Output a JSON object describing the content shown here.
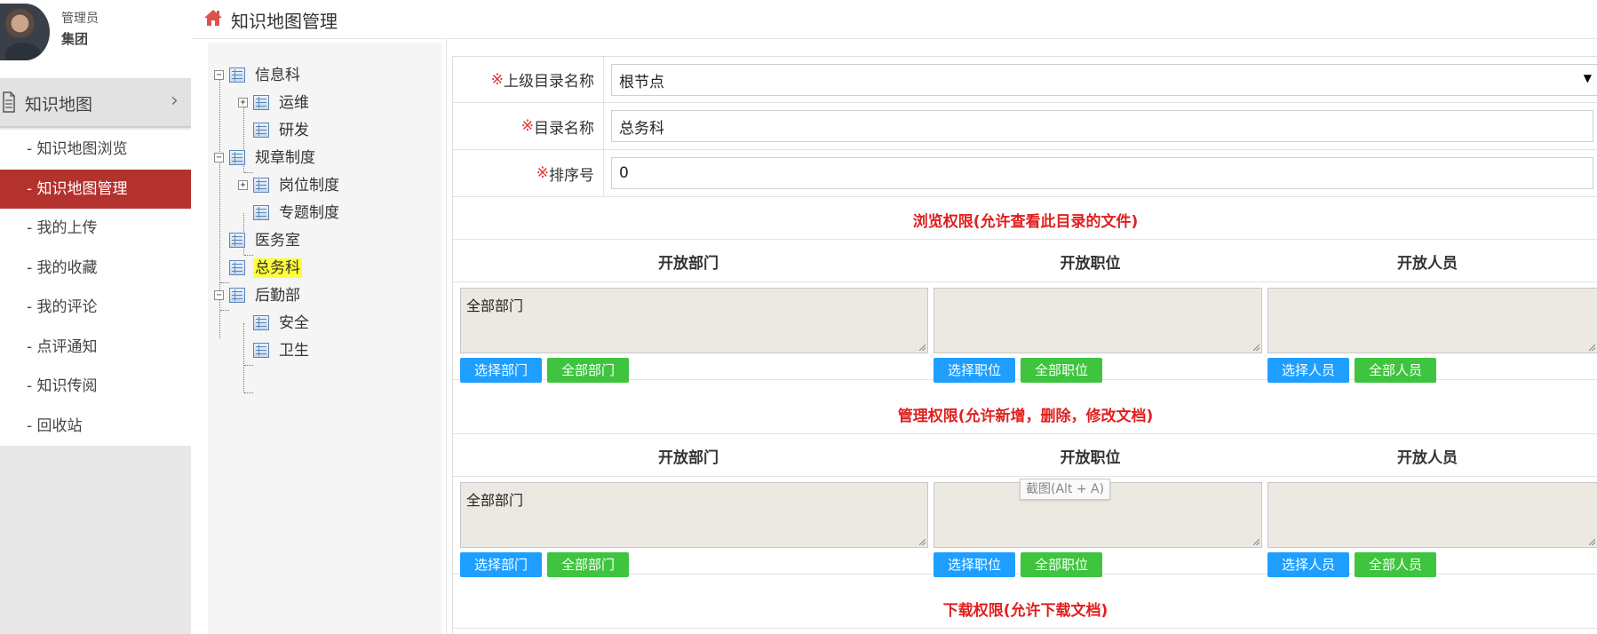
{
  "user": {
    "role": "管理员",
    "org": "集团"
  },
  "menu": {
    "title": "知识地图",
    "items": [
      {
        "label": "- 知识地图浏览",
        "active": false
      },
      {
        "label": "- 知识地图管理",
        "active": true
      },
      {
        "label": "- 我的上传",
        "active": false
      },
      {
        "label": "- 我的收藏",
        "active": false
      },
      {
        "label": "- 我的评论",
        "active": false
      },
      {
        "label": "- 点评通知",
        "active": false
      },
      {
        "label": "- 知识传阅",
        "active": false
      },
      {
        "label": "- 回收站",
        "active": false
      }
    ]
  },
  "header": {
    "title": "知识地图管理"
  },
  "tree": {
    "nodes": [
      {
        "label": "信息科",
        "toggle": "−"
      },
      {
        "label": "运维",
        "toggle": "+"
      },
      {
        "label": "研发"
      },
      {
        "label": "规章制度",
        "toggle": "−"
      },
      {
        "label": "岗位制度",
        "toggle": "+"
      },
      {
        "label": "专题制度"
      },
      {
        "label": "医务室"
      },
      {
        "label": "总务科",
        "selected": true
      },
      {
        "label": "后勤部",
        "toggle": "−"
      },
      {
        "label": "安全"
      },
      {
        "label": "卫生"
      }
    ]
  },
  "form": {
    "required_mark": "※",
    "parent_label": "上级目录名称",
    "parent_value": "根节点",
    "parent_arrow": "▼",
    "name_label": "目录名称",
    "name_value": "总务科",
    "order_label": "排序号",
    "order_value": "0"
  },
  "sections": {
    "browse_title": "浏览权限(允许查看此目录的文件)",
    "manage_title": "管理权限(允许新增，删除，修改文档)",
    "download_title": "下载权限(允许下载文档)",
    "col_dept": "开放部门",
    "col_position": "开放职位",
    "col_person": "开放人员",
    "dept_value": "全部部门",
    "btn_select_dept": "选择部门",
    "btn_all_dept": "全部部门",
    "btn_select_position": "选择职位",
    "btn_all_position": "全部职位",
    "btn_select_person": "选择人员",
    "btn_all_person": "全部人员"
  },
  "tooltip": "截图(Alt + A)",
  "colors": {
    "active_menu": "#b3322d",
    "blue_button": "#1e9fff",
    "green_button": "#3ec43e",
    "section_title": "#e02020"
  },
  "icons": {
    "home": "home-icon",
    "document": "document-icon",
    "chevron": "chevron-right-icon",
    "tree_node": "table-icon"
  }
}
